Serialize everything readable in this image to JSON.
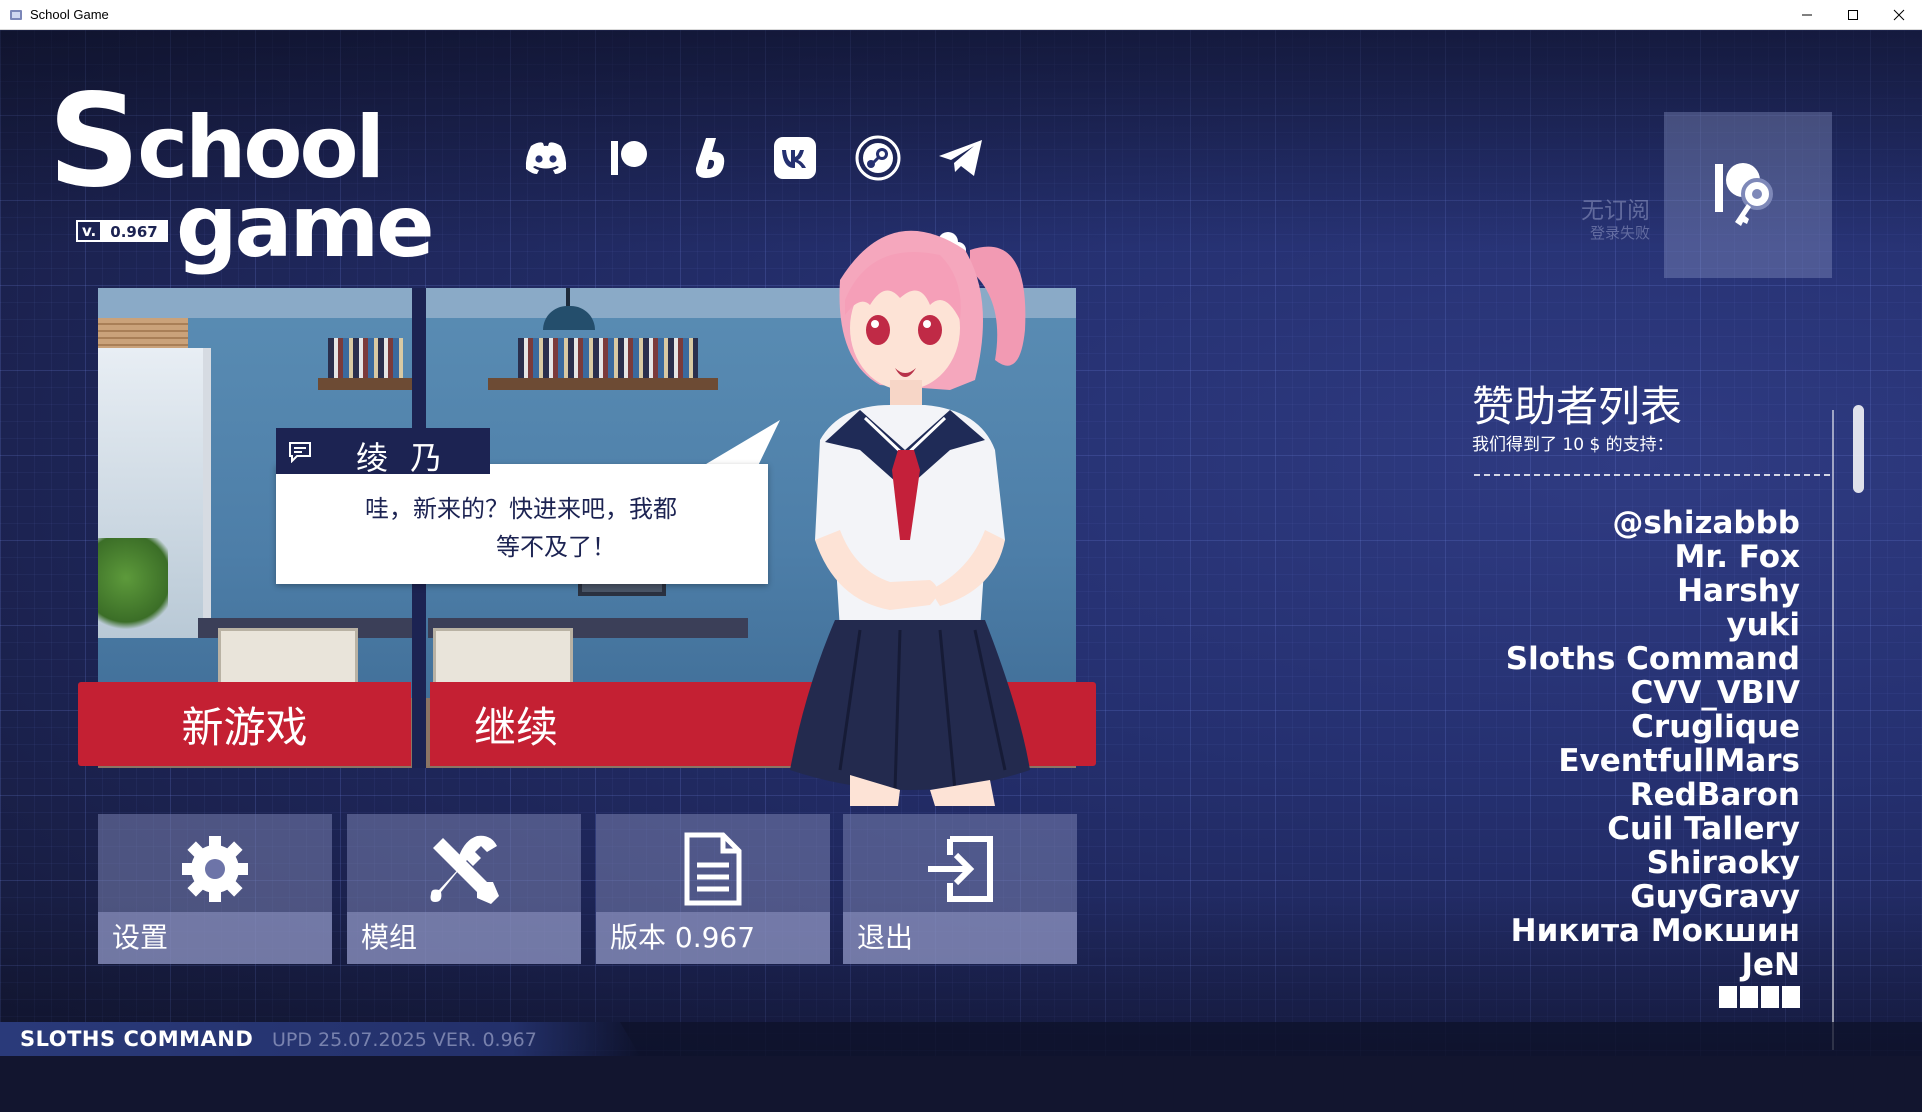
{
  "window": {
    "title": "School Game",
    "minimize": "–",
    "maximize": "☐",
    "close": "✕"
  },
  "logo": {
    "line1_first": "S",
    "line1_rest": "chool",
    "line2": "game",
    "version_prefix": "v.",
    "version": "0.967"
  },
  "socials": [
    "discord-icon",
    "patreon-icon",
    "boosty-icon",
    "vk-icon",
    "steam-icon",
    "telegram-icon"
  ],
  "login": {
    "status": "无订阅",
    "error": "登录失败"
  },
  "dialogue": {
    "speaker": "绫 乃",
    "line1": "哇，新来的？快进来吧，我都",
    "line2": "等不及了！"
  },
  "buttons": {
    "new_game": "新游戏",
    "continue": "继续"
  },
  "tiles": [
    {
      "label": "设置",
      "icon": "gear-icon"
    },
    {
      "label": "模组",
      "icon": "tools-icon"
    },
    {
      "label": "版本 0.967",
      "icon": "document-icon"
    },
    {
      "label": "退出",
      "icon": "exit-icon"
    }
  ],
  "sponsors": {
    "title": "赞助者列表",
    "subtitle": "我们得到了 10 $ 的支持：",
    "names": [
      "@shizabbb",
      "Mr. Fox",
      "Harshy",
      "yuki",
      "Sloths Command",
      "CVV_VBIV",
      "Cruglique",
      "EventfullMars",
      "RedBaron",
      "Cuil Tallery",
      "Shiraoky",
      "GuyGravy",
      "Никита Мокшин",
      "JeN"
    ]
  },
  "footer": {
    "studio": "SLOTHS COMMAND",
    "update": "UPD 25.07.2025 VER. 0.967"
  },
  "colors": {
    "accent_red": "#c42033",
    "navy": "#1c2352",
    "bg": "#253070"
  }
}
